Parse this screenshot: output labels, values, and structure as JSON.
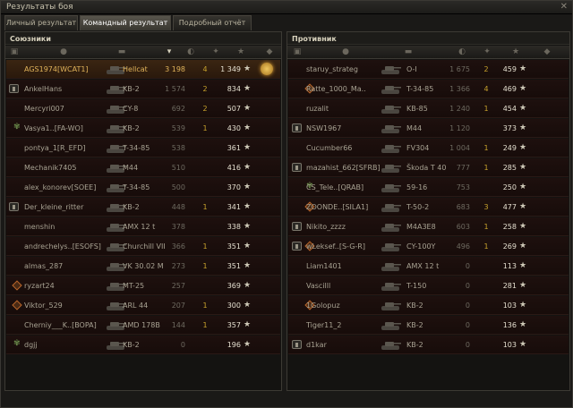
{
  "window": {
    "title": "Результаты боя",
    "close": "✕"
  },
  "tabs": [
    "Личный результат",
    "Командный результат",
    "Подробный отчёт"
  ],
  "allies": {
    "title": "Союзники",
    "rows": [
      {
        "name": "AGS1974[WCAT1]",
        "tank": "Hellcat",
        "xp": "3 198",
        "frags": "4",
        "score": "1 349",
        "me": true,
        "medal": true
      },
      {
        "name": "AnkelHans",
        "tank": "KB-2",
        "xp": "1 574",
        "frags": "2",
        "score": "834",
        "plat": true
      },
      {
        "name": "Mercyri007",
        "tank": "CY-8",
        "xp": "692",
        "frags": "2",
        "score": "507"
      },
      {
        "name": "Vasya1..[FA-WO]",
        "tank": "KB-2",
        "xp": "539",
        "frags": "1",
        "score": "430",
        "pat": true
      },
      {
        "name": "pontya_1[R_EFD]",
        "tank": "T-34-85",
        "xp": "538",
        "frags": "",
        "score": "361"
      },
      {
        "name": "Mechanik7405",
        "tank": "M44",
        "xp": "510",
        "frags": "",
        "score": "416"
      },
      {
        "name": "alex_konorev[SOEE]",
        "tank": "T-34-85",
        "xp": "500",
        "frags": "",
        "score": "370"
      },
      {
        "name": "Der_kleine_ritter",
        "tank": "KB-2",
        "xp": "448",
        "frags": "1",
        "score": "341",
        "plat": true
      },
      {
        "name": "menshin",
        "tank": "AMX 12 t",
        "xp": "378",
        "frags": "",
        "score": "338"
      },
      {
        "name": "andrechelys..[ESOFS]",
        "tank": "Churchill VII",
        "xp": "366",
        "frags": "1",
        "score": "351"
      },
      {
        "name": "almas_287",
        "tank": "VK 30.02 M",
        "xp": "273",
        "frags": "1",
        "score": "351"
      },
      {
        "name": "ryzart24",
        "tank": "MT-25",
        "xp": "257",
        "frags": "",
        "score": "369",
        "dia": true
      },
      {
        "name": "Viktor_529",
        "tank": "ARL 44",
        "xp": "207",
        "frags": "1",
        "score": "300",
        "dia": true
      },
      {
        "name": "Cherniy___K..[BOPA]",
        "tank": "AMD 178B",
        "xp": "144",
        "frags": "1",
        "score": "357"
      },
      {
        "name": "dgjj",
        "tank": "KB-2",
        "xp": "0",
        "frags": "",
        "score": "196",
        "pat": true
      }
    ]
  },
  "enemies": {
    "title": "Противник",
    "rows": [
      {
        "name": "staruy_strateg",
        "tank": "O-I",
        "xp": "1 675",
        "frags": "2",
        "score": "459"
      },
      {
        "name": "Ratte_1000_Ma..",
        "tank": "T-34-85",
        "xp": "1 366",
        "frags": "4",
        "score": "469",
        "dia": true
      },
      {
        "name": "ruzalit",
        "tank": "KB-85",
        "xp": "1 240",
        "frags": "1",
        "score": "454"
      },
      {
        "name": "NSW1967",
        "tank": "M44",
        "xp": "1 120",
        "frags": "",
        "score": "373",
        "plat": true
      },
      {
        "name": "Cucumber66",
        "tank": "FV304",
        "xp": "1 004",
        "frags": "1",
        "score": "249"
      },
      {
        "name": "mazahist_662[SFRB]",
        "tank": "Škoda T 40",
        "xp": "777",
        "frags": "1",
        "score": "285",
        "plat": true
      },
      {
        "name": "CS_Tele..[QRAB]",
        "tank": "59-16",
        "xp": "753",
        "frags": "",
        "score": "250",
        "pat": true
      },
      {
        "name": "ZOONDE..[SILA1]",
        "tank": "T-50-2",
        "xp": "683",
        "frags": "3",
        "score": "477",
        "dia": true
      },
      {
        "name": "Nikito_zzzz",
        "tank": "M4A3E8",
        "xp": "603",
        "frags": "1",
        "score": "258",
        "plat": true
      },
      {
        "name": "wLeksef..[S-G-R]",
        "tank": "CY-100Y",
        "xp": "496",
        "frags": "1",
        "score": "269",
        "plat": true,
        "dia": true
      },
      {
        "name": "Liam1401",
        "tank": "AMX 12 t",
        "xp": "0",
        "frags": "",
        "score": "113"
      },
      {
        "name": "Vascilll",
        "tank": "T-150",
        "xp": "0",
        "frags": "",
        "score": "281"
      },
      {
        "name": "1Golopuz",
        "tank": "KB-2",
        "xp": "0",
        "frags": "",
        "score": "103",
        "dia": true
      },
      {
        "name": "Tiger11_2",
        "tank": "KB-2",
        "xp": "0",
        "frags": "",
        "score": "136"
      },
      {
        "name": "d1kar",
        "tank": "KB-2",
        "xp": "0",
        "frags": "",
        "score": "103",
        "plat": true
      }
    ]
  }
}
